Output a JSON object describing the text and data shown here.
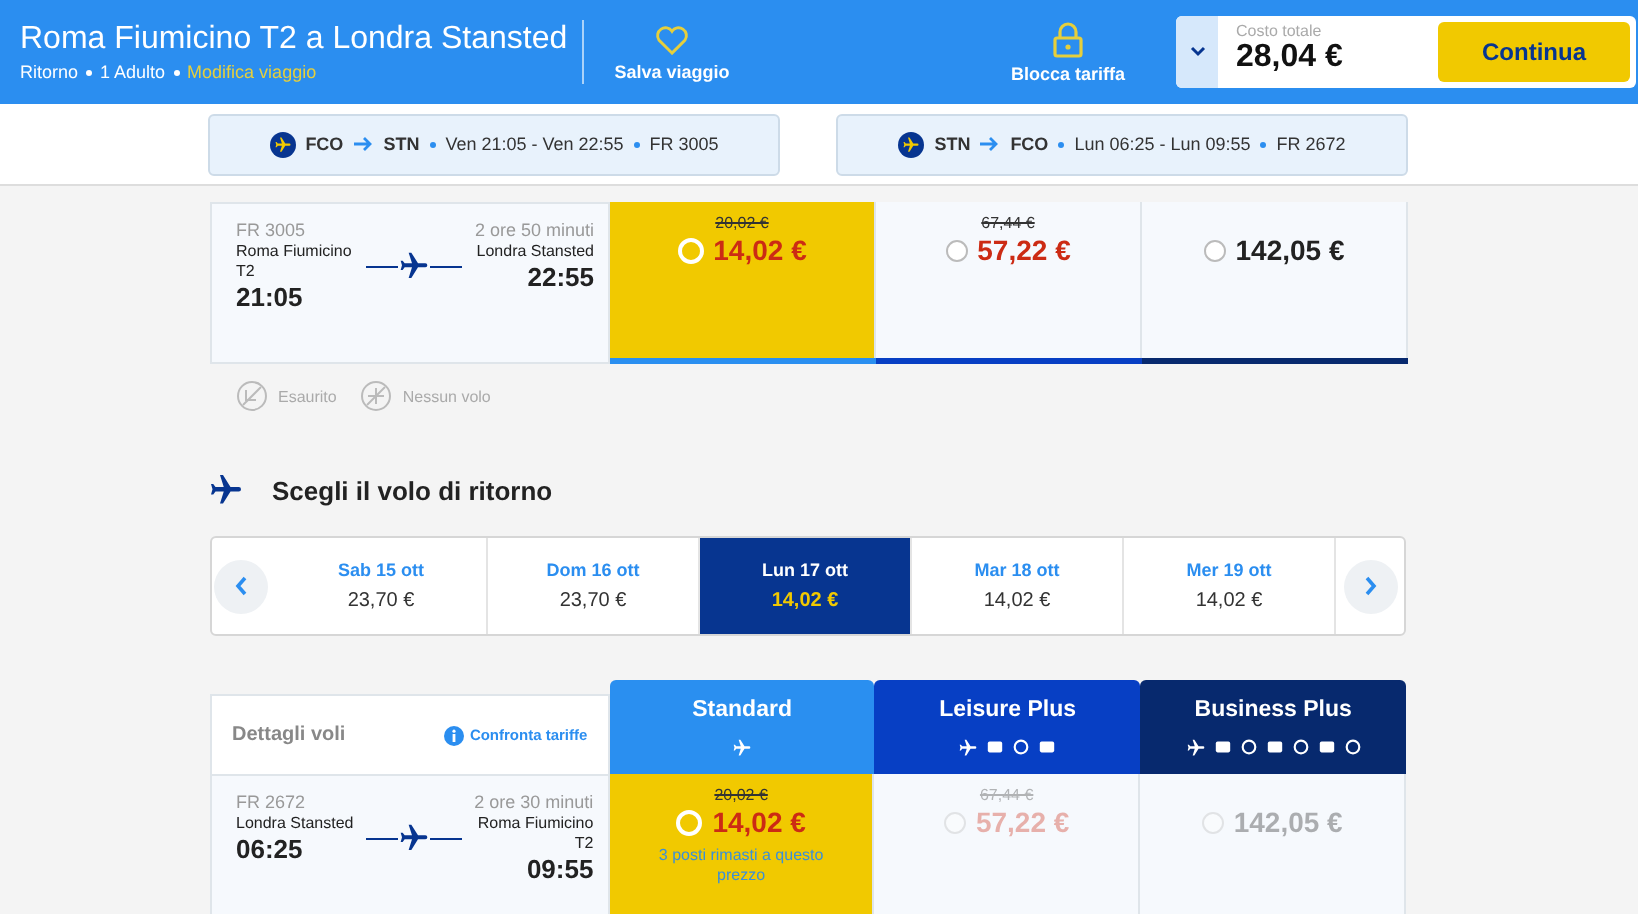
{
  "header": {
    "title": "Roma Fiumicino T2 a Londra Stansted",
    "trip_info": [
      "Ritorno",
      "1 Adulto"
    ],
    "modify_link": "Modifica viaggio",
    "save_label": "Salva viaggio",
    "lock_label": "Blocca tariffa",
    "total_label": "Costo totale",
    "total_value": "28,04 €",
    "continue_label": "Continua"
  },
  "chips": [
    {
      "from": "FCO",
      "to": "STN",
      "times": "Ven 21:05 - Ven 22:55",
      "flight": "FR 3005"
    },
    {
      "from": "STN",
      "to": "FCO",
      "times": "Lun 06:25 - Lun 09:55",
      "flight": "FR 2672"
    }
  ],
  "outbound": {
    "flight": "FR 3005",
    "duration": "2 ore 50 minuti",
    "origin": "Roma Fiumicino",
    "origin_terminal": "T2",
    "depart": "21:05",
    "destination": "Londra Stansted",
    "arrive": "22:55",
    "fares": [
      {
        "old_price": "20,02 €",
        "price": "14,02 €",
        "selected": true,
        "disabled": false,
        "color": "#2a8ff0"
      },
      {
        "old_price": "67,44 €",
        "price": "57,22 €",
        "selected": false,
        "disabled": false,
        "color": "#073fc4"
      },
      {
        "price": "142,05 €",
        "selected": false,
        "disabled": false,
        "color": "#07296e"
      }
    ]
  },
  "legend": [
    {
      "kind": "sold_out",
      "label": "Esaurito"
    },
    {
      "kind": "no_flight",
      "label": "Nessun volo"
    }
  ],
  "return_section": {
    "title": "Scegli il volo di ritorno",
    "dates": [
      {
        "day": "Sab 15 ott",
        "price": "23,70 €",
        "selected": false
      },
      {
        "day": "Dom 16 ott",
        "price": "23,70 €",
        "selected": false
      },
      {
        "day": "Lun 17 ott",
        "price": "14,02 €",
        "selected": true
      },
      {
        "day": "Mar 18 ott",
        "price": "14,02 €",
        "selected": false
      },
      {
        "day": "Mer 19 ott",
        "price": "14,02 €",
        "selected": false
      }
    ],
    "details_label": "Dettagli voli",
    "compare_link": "Confronta tariffe",
    "fare_columns": [
      {
        "kind": "standard",
        "name": "Standard",
        "color": "#2a8ff0"
      },
      {
        "kind": "leisure",
        "name": "Leisure Plus",
        "color": "#073fc4"
      },
      {
        "kind": "business",
        "name": "Business Plus",
        "color": "#07296e"
      }
    ],
    "flight": {
      "flight": "FR 2672",
      "duration": "2 ore 30 minuti",
      "origin": "Londra Stansted",
      "depart": "06:25",
      "destination": "Roma Fiumicino",
      "destination_terminal": "T2",
      "arrive": "09:55",
      "fares": [
        {
          "old_price": "20,02 €",
          "price": "14,02 €",
          "selected": true,
          "disabled": false,
          "note": "3 posti rimasti a questo prezzo"
        },
        {
          "old_price": "67,44 €",
          "price": "57,22 €",
          "selected": false,
          "disabled": true
        },
        {
          "price": "142,05 €",
          "selected": false,
          "disabled": true
        }
      ]
    }
  }
}
